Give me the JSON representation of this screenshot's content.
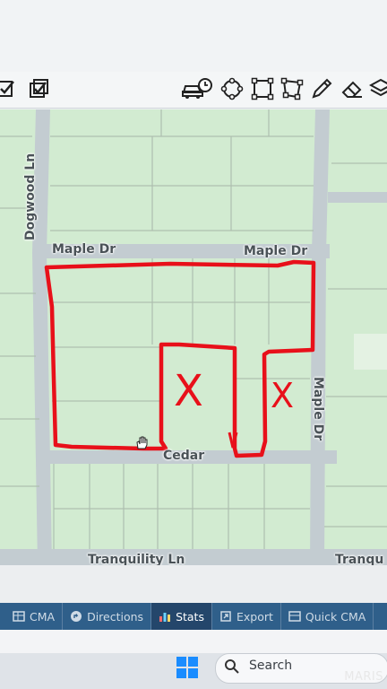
{
  "toolbar": {
    "icons": [
      "check-square-icon",
      "check-multiple-icon",
      "drive-time-icon",
      "circle-draw-icon",
      "rectangle-draw-icon",
      "polygon-draw-icon",
      "pencil-icon",
      "eraser-icon",
      "layers-icon"
    ]
  },
  "map": {
    "streets": {
      "dogwood": "Dogwood Ln",
      "maple_left": "Maple Dr",
      "maple_right": "Maple Dr",
      "maple_vertical": "Maple Dr",
      "cedar": "Cedar",
      "tranquility": "Tranquility Ln",
      "tranquility_right": "Tranqu"
    },
    "markers": [
      "X",
      "X"
    ],
    "colors": {
      "parcel_fill": "#cfe9cf",
      "road": "#c2ccd2",
      "outline": "#e8101a"
    }
  },
  "tabs": [
    {
      "label": "CMA",
      "icon": "table-icon",
      "active": false
    },
    {
      "label": "Directions",
      "icon": "directions-icon",
      "active": false
    },
    {
      "label": "Stats",
      "icon": "stats-icon",
      "active": true
    },
    {
      "label": "Export",
      "icon": "export-icon",
      "active": false
    },
    {
      "label": "Quick CMA",
      "icon": "quick-cma-icon",
      "active": false
    }
  ],
  "taskbar": {
    "search_placeholder": "Search"
  },
  "watermark": "MARIS"
}
